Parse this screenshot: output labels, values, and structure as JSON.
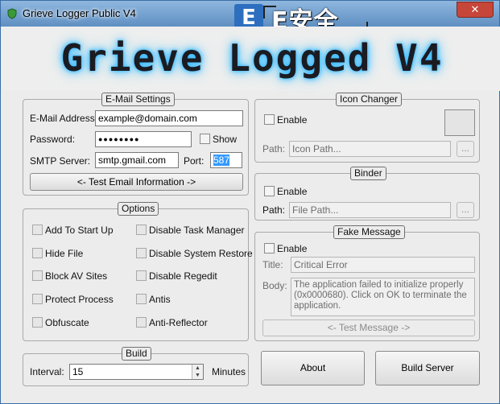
{
  "window": {
    "title": "Grieve Logger Public V4",
    "close_label": "✕",
    "banner_text": "Grieve Logged V4"
  },
  "watermark": {
    "logo_letter": "E",
    "text": "E安全"
  },
  "email_settings": {
    "legend": "E-Mail Settings",
    "email_label": "E-Mail Address:",
    "email_value": "example@domain.com",
    "password_label": "Password:",
    "password_value": "●●●●●●●●",
    "show_label": "Show",
    "smtp_label": "SMTP Server:",
    "smtp_value": "smtp.gmail.com",
    "port_label": "Port:",
    "port_value": "587",
    "test_button": "<- Test Email Information ->"
  },
  "options": {
    "legend": "Options",
    "left": [
      "Add To Start Up",
      "Hide File",
      "Block AV Sites",
      "Protect Process",
      "Obfuscate"
    ],
    "right": [
      "Disable Task Manager",
      "Disable System Restore",
      "Disable Regedit",
      "Antis",
      "Anti-Reflector"
    ]
  },
  "build": {
    "legend": "Build",
    "interval_label": "Interval:",
    "interval_value": "15",
    "minutes_label": "Minutes"
  },
  "icon_changer": {
    "legend": "Icon Changer",
    "enable_label": "Enable",
    "path_label": "Path:",
    "path_placeholder": "Icon Path...",
    "browse_label": "..."
  },
  "binder": {
    "legend": "Binder",
    "enable_label": "Enable",
    "path_label": "Path:",
    "path_placeholder": "File Path...",
    "browse_label": "..."
  },
  "fake_message": {
    "legend": "Fake Message",
    "enable_label": "Enable",
    "title_label": "Title:",
    "title_value": "Critical Error",
    "body_label": "Body:",
    "body_value": "The application failed to initialize properly (0x0000680). Click on OK to terminate the application.",
    "test_button": "<- Test Message ->"
  },
  "actions": {
    "about_label": "About",
    "build_label": "Build Server"
  }
}
